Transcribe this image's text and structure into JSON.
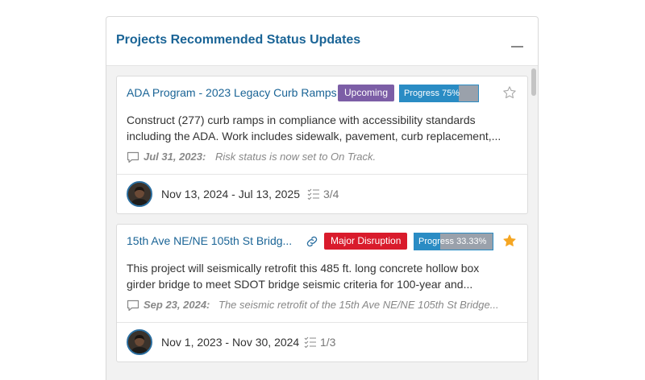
{
  "panel": {
    "title": "Projects Recommended Status Updates"
  },
  "projects": [
    {
      "title": "ADA Program - 2023 Legacy Curb Ramps",
      "status": "Upcoming",
      "status_color": "#7c5ea6",
      "progress_label": "Progress 75%",
      "progress": 75,
      "starred": false,
      "has_link": false,
      "description": [
        "Construct (277) curb ramps in compliance with accessibility standards",
        "including the ADA. Work includes sidewalk, pavement, curb replacement,..."
      ],
      "comment_date": "Jul 31, 2023:",
      "comment_text": "Risk status is now set to On Track.",
      "date_range": "Nov 13, 2024 - Jul 13, 2025",
      "tasks": "3/4"
    },
    {
      "title": "15th Ave NE/NE 105th St Bridg...",
      "status": "Major Disruption",
      "status_color": "#d91b2c",
      "progress_label": "Progress 33.33%",
      "progress": 33.33,
      "starred": true,
      "has_link": true,
      "description": [
        "This project will seismically retrofit this 485 ft. long concrete hollow box",
        "girder bridge to meet SDOT bridge seismic criteria for 100-year and..."
      ],
      "comment_date": "Sep 23, 2024:",
      "comment_text": "The seismic retrofit of the 15th Ave NE/NE 105th St Bridge...",
      "date_range": "Nov 1, 2023 - Nov 30, 2024",
      "tasks": "1/3"
    }
  ],
  "colors": {
    "accent": "#1a6496",
    "progress": "#2a8cc4",
    "star_active": "#f5a623"
  }
}
